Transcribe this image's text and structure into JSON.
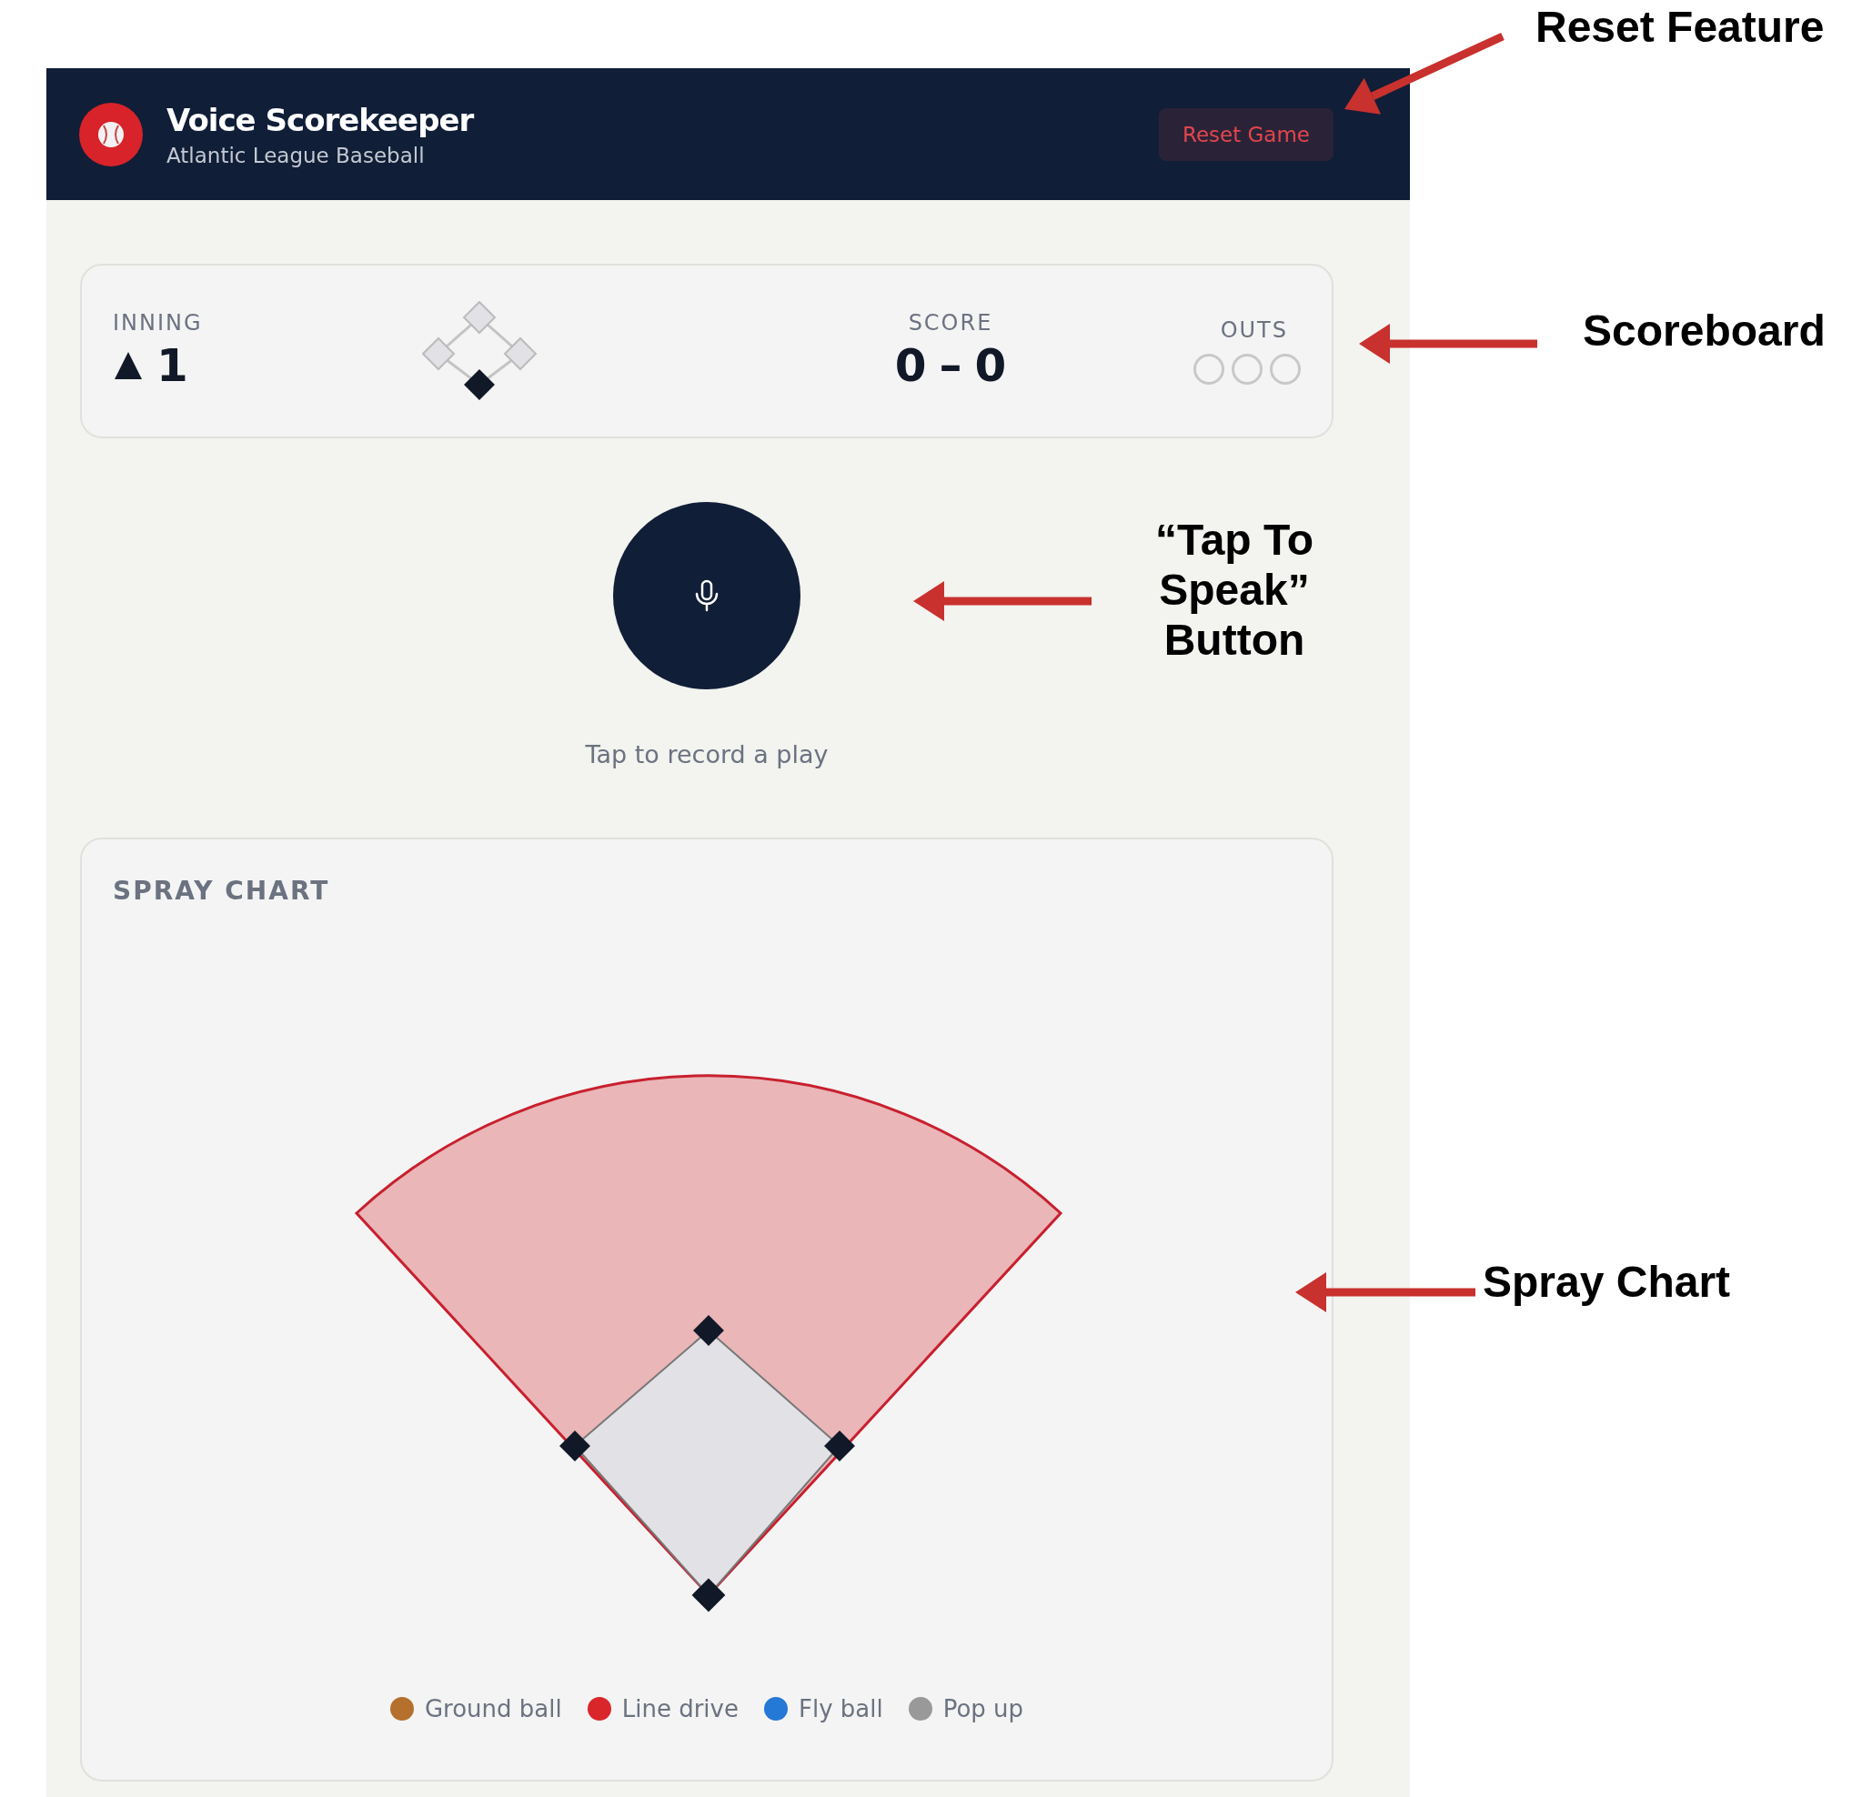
{
  "header": {
    "title": "Voice Scorekeeper",
    "subtitle": "Atlantic League Baseball",
    "reset_button": "Reset Game"
  },
  "scoreboard": {
    "inning_label": "INNING",
    "top_half": true,
    "inning": "1",
    "bases": [
      {
        "occupied": false
      },
      {
        "occupied": false
      },
      {
        "occupied": false
      }
    ],
    "score_label": "SCORE",
    "home_score": "0",
    "separator": "–",
    "away_score": "0",
    "outs_label": "OUTS",
    "outs": [
      {
        "on": false
      },
      {
        "on": false
      },
      {
        "on": false
      }
    ]
  },
  "record": {
    "caption": "Tap to record a play"
  },
  "spray_chart": {
    "title": "SPRAY CHART",
    "legend": [
      {
        "label": "Ground ball",
        "color": "#b5702e"
      },
      {
        "label": "Line drive",
        "color": "#d9262b"
      },
      {
        "label": "Fly ball",
        "color": "#2478d6"
      },
      {
        "label": "Pop up",
        "color": "#999999"
      }
    ]
  },
  "annotations": [
    {
      "kind": "reset",
      "text": "Reset Feature"
    },
    {
      "kind": "scoreboard",
      "text": "Scoreboard"
    },
    {
      "kind": "speak",
      "text": "“Tap To Speak” Button"
    },
    {
      "kind": "spray",
      "text": "Spray Chart"
    }
  ]
}
